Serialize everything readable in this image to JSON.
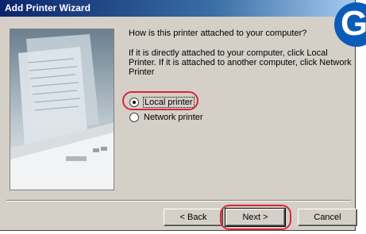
{
  "window": {
    "title": "Add Printer Wizard"
  },
  "badge": {
    "letter": "G"
  },
  "content": {
    "question": "How is this printer attached to your computer?",
    "instructions": "If it is directly attached to your computer, click Local Printer. If it is attached to another computer, click Network Printer"
  },
  "options": [
    {
      "label": "Local printer",
      "selected": true
    },
    {
      "label": "Network printer",
      "selected": false
    }
  ],
  "buttons": {
    "back": "< Back",
    "next": "Next >",
    "cancel": "Cancel"
  },
  "colors": {
    "highlight": "#d7263d",
    "title_bar": "#0a246a",
    "dialog_bg": "#d4d0c8",
    "badge": "#0a5cb8"
  }
}
